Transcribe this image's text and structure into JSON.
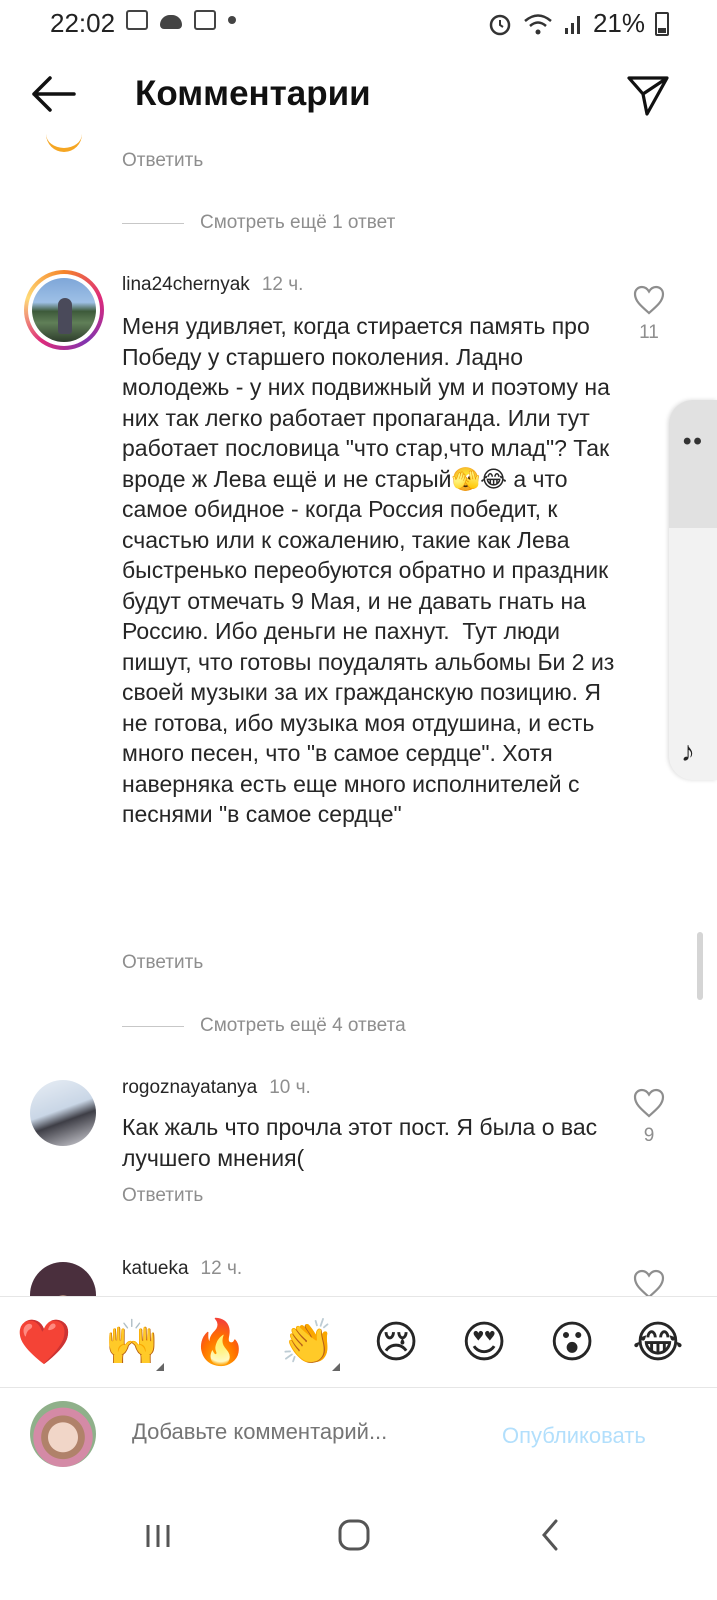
{
  "status_bar": {
    "time": "22:02",
    "battery": "21%"
  },
  "header": {
    "title": "Комментарии"
  },
  "top": {
    "reply_label": "Ответить",
    "more_replies": "Смотреть ещё 1 ответ"
  },
  "comments": [
    {
      "username": "lina24chernyak",
      "time": "12 ч.",
      "text": "Меня удивляет, когда стирается память про Победу у старшего поколения. Ладно молодежь - у них подвижный ум и поэтому на них так легко работает пропаганда. Или тут работает пословица \"что стар,что млад\"? Так вроде ж Лева ещё и не старый🫣😂 а что самое обидное - когда Россия победит, к счастью или к сожалению, такие как Лева быстренько переобуются обратно и праздник будут отмечать 9 Мая, и не давать гнать на Россию. Ибо деньги не пахнут.  Тут люди пишут, что готовы поудалять альбомы Би 2 из своей музыки за их гражданскую позицию. Я не готова, ибо музыка моя отдушина, и есть много песен, что \"в самое сердце\". Хотя наверняка есть еще много исполнителей с песнями \"в самое сердце\"",
      "likes": "11",
      "reply_label": "Ответить",
      "more_replies": "Смотреть ещё 4 ответа"
    },
    {
      "username": "rogoznayatanya",
      "time": "10 ч.",
      "text": "Как жаль что прочла этот пост. Я была о вас лучшего мнения(",
      "likes": "9",
      "reply_label": "Ответить"
    },
    {
      "username": "katueka",
      "time": "12 ч."
    }
  ],
  "emoji_bar": [
    "❤️",
    "🙌",
    "🔥",
    "👏",
    "😢",
    "😍",
    "😮",
    "😂"
  ],
  "composer": {
    "placeholder": "Добавьте комментарий...",
    "post_label": "Опубликовать"
  },
  "colors": {
    "link_disabled": "#b2dffc",
    "secondary_text": "#8e8e8e",
    "heart_red": "#ed4956"
  }
}
